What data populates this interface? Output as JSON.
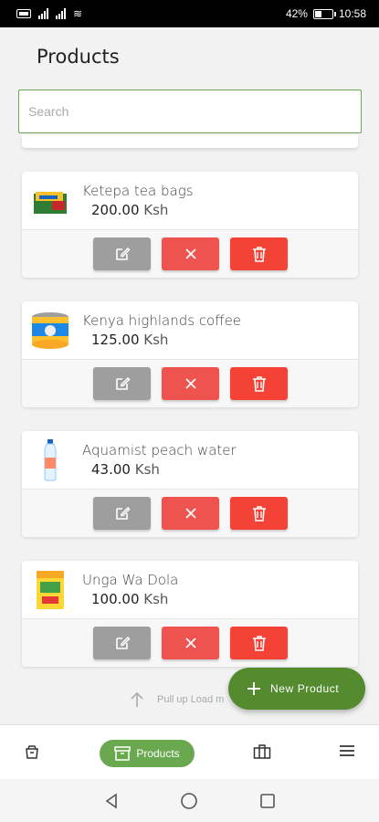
{
  "status_bar": {
    "battery": "42%",
    "time": "10:58",
    "battery_level": 0.42
  },
  "page": {
    "title": "Products"
  },
  "search": {
    "placeholder": "Search",
    "value": ""
  },
  "products": [
    {
      "name": "Ketepa tea bags",
      "price": "200.00",
      "currency": "Ksh",
      "image_icon": "tea-box-icon"
    },
    {
      "name": "Kenya highlands coffee",
      "price": "125.00",
      "currency": "Ksh",
      "image_icon": "coffee-tin-icon"
    },
    {
      "name": "Aquamist peach water",
      "price": "43.00",
      "currency": "Ksh",
      "image_icon": "water-bottle-icon"
    },
    {
      "name": "Unga Wa Dola",
      "price": "100.00",
      "currency": "Ksh",
      "image_icon": "flour-pack-icon"
    }
  ],
  "actions": {
    "edit_icon": "edit-icon",
    "cancel_icon": "close-icon",
    "delete_icon": "trash-icon"
  },
  "pull_hint": {
    "text": "Pull up Load m"
  },
  "fab": {
    "label": "New Product"
  },
  "tabbar": {
    "active_label": "Products"
  },
  "colors": {
    "accent": "#6aa84f",
    "fab": "#558b2f",
    "edit": "#9e9e9e",
    "cancel": "#ef5350",
    "delete": "#f44336"
  }
}
